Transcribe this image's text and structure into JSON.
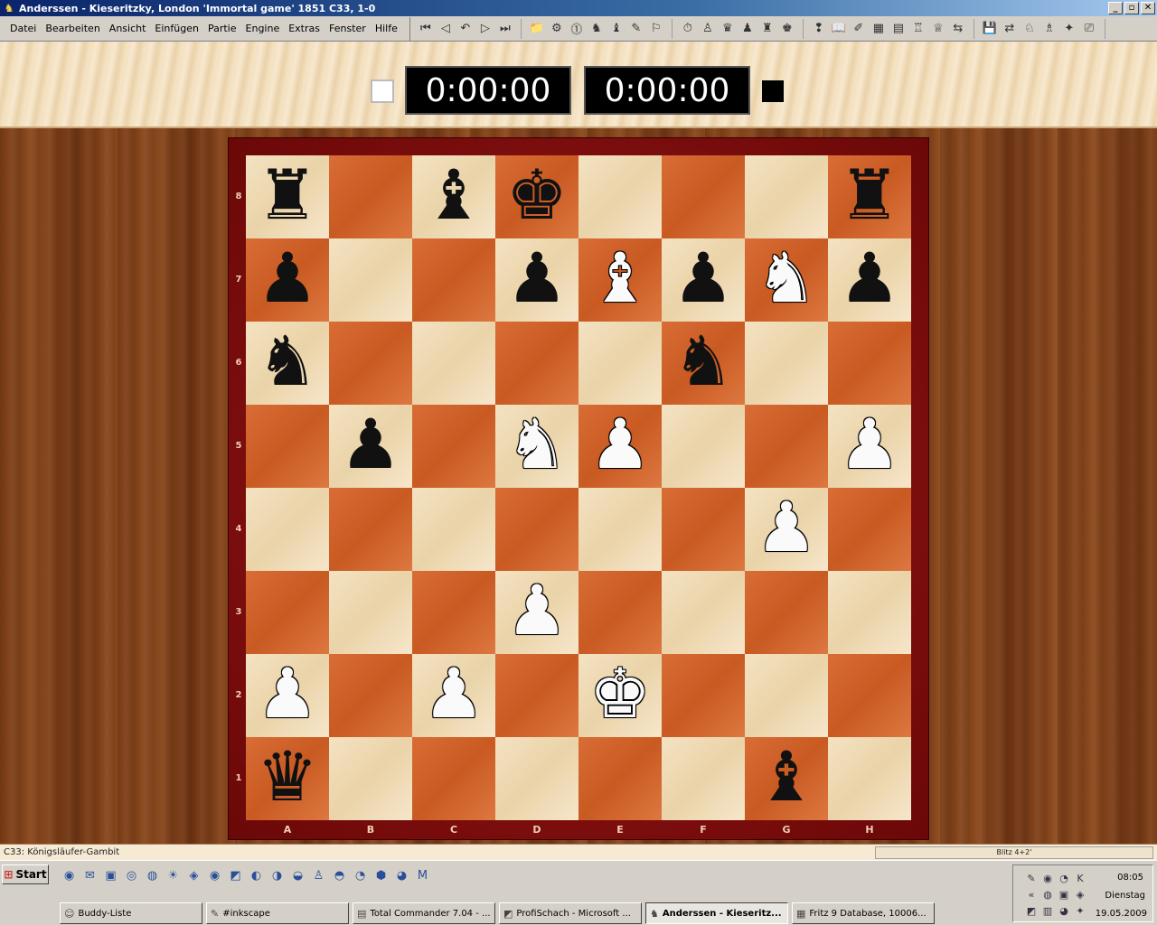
{
  "window": {
    "title": "Anderssen - Kieseritzky, London 'Immortal game' 1851  C33, 1-0",
    "minimize": "_",
    "maximize": "▫",
    "close": "✕"
  },
  "menu": [
    "Datei",
    "Bearbeiten",
    "Ansicht",
    "Einfügen",
    "Partie",
    "Engine",
    "Extras",
    "Fenster",
    "Hilfe"
  ],
  "toolbar": {
    "nav": [
      "⏮",
      "◁",
      "↶",
      "▷",
      "⏭"
    ],
    "group2": [
      "📁",
      "⚙",
      "⓵",
      "♞",
      "♝",
      "✎",
      "⚐"
    ],
    "group3": [
      "⏱",
      "♙",
      "♛",
      "♟",
      "♜",
      "♚"
    ],
    "group4": [
      "❢",
      "📖",
      "✐",
      "▦",
      "▤",
      "♖",
      "♕",
      "⇆"
    ],
    "group5": [
      "💾",
      "⇄",
      "♘",
      "♗",
      "✦",
      "⎚"
    ]
  },
  "clocks": {
    "white_time": "0:00:00",
    "black_time": "0:00:00"
  },
  "board": {
    "files": [
      "A",
      "B",
      "C",
      "D",
      "E",
      "F",
      "G",
      "H"
    ],
    "ranks": [
      "8",
      "7",
      "6",
      "5",
      "4",
      "3",
      "2",
      "1"
    ],
    "squares": [
      [
        "♜b",
        "",
        "♝b",
        "♚b",
        "",
        "",
        "",
        "♜b"
      ],
      [
        "♟b",
        "",
        "",
        "♟b",
        "♗w",
        "♟b",
        "♘w",
        "♟b"
      ],
      [
        "♞b",
        "",
        "",
        "",
        "",
        "♞b",
        "",
        ""
      ],
      [
        "",
        "♟b",
        "",
        "♘w",
        "♙w",
        "",
        "",
        "♙w"
      ],
      [
        "",
        "",
        "",
        "",
        "",
        "",
        "♙w",
        ""
      ],
      [
        "",
        "",
        "",
        "♙w",
        "",
        "",
        "",
        ""
      ],
      [
        "♙w",
        "",
        "♙w",
        "",
        "♔w",
        "",
        "",
        ""
      ],
      [
        "♛b",
        "",
        "",
        "",
        "",
        "",
        "♝b",
        ""
      ]
    ]
  },
  "status": {
    "opening": "C33: Königsläufer-Gambit",
    "blitz": "Blitz 4+2'"
  },
  "taskbar": {
    "start": "Start",
    "quicklaunch": [
      "◉",
      "✉",
      "▣",
      "◎",
      "◍",
      "☀",
      "◈",
      "◉",
      "◩",
      "◐",
      "◑",
      "◒",
      "♙",
      "◓",
      "◔",
      "⬢",
      "◕",
      "M"
    ],
    "tasks": [
      {
        "label": "Buddy-Liste",
        "icon": "☺",
        "active": false
      },
      {
        "label": "#inkscape",
        "icon": "✎",
        "active": false
      },
      {
        "label": "Total Commander 7.04 - ...",
        "icon": "▤",
        "active": false
      },
      {
        "label": "ProfiSchach - Microsoft ...",
        "icon": "◩",
        "active": false
      },
      {
        "label": "Anderssen - Kieseritz...",
        "icon": "♞",
        "active": true
      },
      {
        "label": "Fritz 9 Database,   10006...",
        "icon": "▦",
        "active": false
      }
    ],
    "tray_icons": [
      "✎",
      "◉",
      "◔",
      "K",
      "«",
      "◍",
      "▣",
      "◈",
      "◩",
      "▥",
      "◕",
      "✦"
    ],
    "time": "08:05",
    "day": "Dienstag",
    "date": "19.05.2009"
  }
}
